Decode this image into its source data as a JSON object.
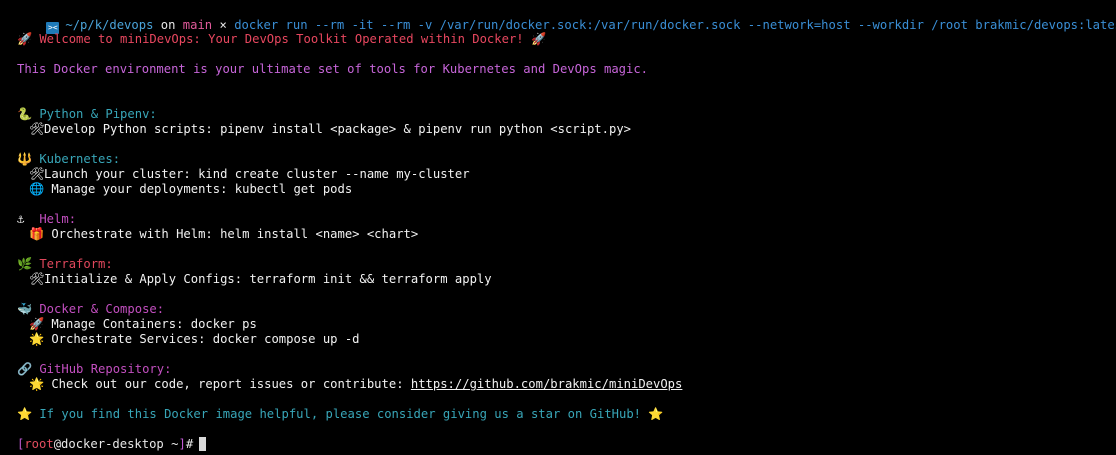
{
  "shell_prompt": {
    "icon": "terminal-icon",
    "path": "~/p/k/devops",
    "on": "on",
    "branch": "main",
    "dirty_mark": "×",
    "command": "docker run --rm -it --rm -v /var/run/docker.sock:/var/run/docker.sock --network=host --workdir /root brakmic/devops:latest"
  },
  "welcome": {
    "emoji_left": "🚀",
    "text": "Welcome to miniDevOps: Your DevOps Toolkit Operated within Docker!",
    "emoji_right": "🚀"
  },
  "intro": "This Docker environment is your ultimate set of tools for Kubernetes and DevOps magic.",
  "sections": [
    {
      "emoji": "🐍",
      "title": "Python & Pipenv:",
      "color": "#38a6b8",
      "items": [
        {
          "emoji": "🛠",
          "text": "Develop Python scripts: pipenv install <package> & pipenv run python <script.py>"
        }
      ]
    },
    {
      "emoji": "🔱",
      "title": "Kubernetes:",
      "color": "#38a6b8",
      "items": [
        {
          "emoji": "🛠",
          "text": "Launch your cluster: kind create cluster --name my-cluster"
        },
        {
          "emoji": "🌐",
          "text": " Manage your deployments: kubectl get pods"
        }
      ]
    },
    {
      "emoji": "⚓",
      "title": "Helm:",
      "color": "#c34fc0",
      "items": [
        {
          "emoji": "🎁",
          "text": " Orchestrate with Helm: helm install <name> <chart>"
        }
      ]
    },
    {
      "emoji": "🌿",
      "title": "Terraform:",
      "color": "#e0475c",
      "items": [
        {
          "emoji": "🛠",
          "text": "Initialize & Apply Configs: terraform init && terraform apply"
        }
      ]
    },
    {
      "emoji": "🐳",
      "title": "Docker & Compose:",
      "color": "#c34fc0",
      "items": [
        {
          "emoji": "🚀",
          "text": " Manage Containers: docker ps"
        },
        {
          "emoji": "🌟",
          "text": " Orchestrate Services: docker compose up -d"
        }
      ]
    },
    {
      "emoji": "🔗",
      "title": "GitHub Repository:",
      "color": "#c34fc0",
      "items": [
        {
          "emoji": "🌟",
          "text": " Check out our code, report issues or contribute: ",
          "link": "https://github.com/brakmic/miniDevOps"
        }
      ]
    }
  ],
  "footer": {
    "emoji_left": "⭐",
    "text": "If you find this Docker image helpful, please consider giving us a star on GitHub!",
    "emoji_right": "⭐"
  },
  "final_prompt": {
    "open": "[",
    "user": "root",
    "at": "@",
    "host": "docker-desktop",
    "dir": "~",
    "close": "]",
    "symbol": "#"
  },
  "colors": {
    "background": "#000000",
    "command": "#3a8fd6",
    "welcome": "#e8475f",
    "intro": "#c765d9",
    "footer": "#38a6b8"
  }
}
